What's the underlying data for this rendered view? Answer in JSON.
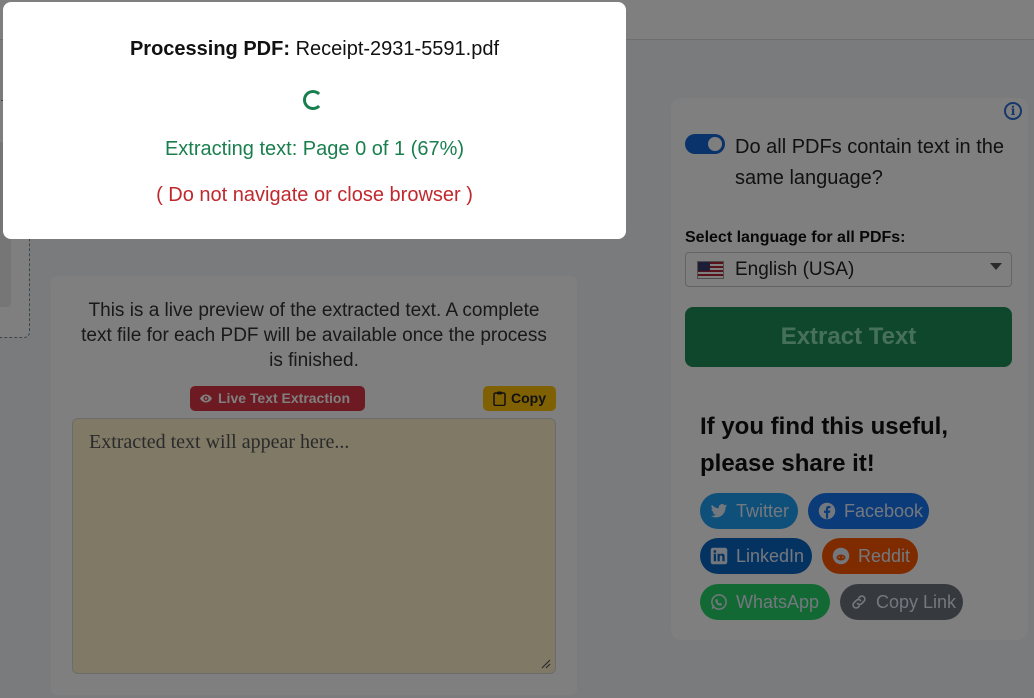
{
  "modal": {
    "title_label": "Processing PDF:",
    "filename": "Receipt-2931-5591.pdf",
    "progress_text": "Extracting text: Page 0 of 1 (67%)",
    "warning": "( Do not navigate or close browser )"
  },
  "preview": {
    "description": "This is a live preview of the extracted text. A complete text file for each PDF will be available once the process is finished.",
    "live_badge": "Live Text Extraction",
    "copy_badge": "Copy",
    "textarea_placeholder": "Extracted text will appear here..."
  },
  "settings": {
    "same_language_toggle_label": "Do all PDFs contain text in the same language?",
    "same_language_toggle_on": true,
    "language_label": "Select language for all PDFs:",
    "selected_language": "English (USA)",
    "extract_button": "Extract Text"
  },
  "share": {
    "title": "If you find this useful, please share it!",
    "buttons": [
      {
        "label": "Twitter",
        "icon": "twitter-icon",
        "color": "#1da1f2"
      },
      {
        "label": "Facebook",
        "icon": "facebook-icon",
        "color": "#1877f2"
      },
      {
        "label": "LinkedIn",
        "icon": "linkedin-icon",
        "color": "#0a66c2"
      },
      {
        "label": "Reddit",
        "icon": "reddit-icon",
        "color": "#ff5700"
      },
      {
        "label": "WhatsApp",
        "icon": "whatsapp-icon",
        "color": "#25d366"
      },
      {
        "label": "Copy Link",
        "icon": "link-icon",
        "color": "#6c757d"
      }
    ]
  },
  "colors": {
    "accent_green": "#1a7f4e",
    "warning_red": "#c0282e",
    "overlay": "rgba(0,0,0,0.5)"
  }
}
